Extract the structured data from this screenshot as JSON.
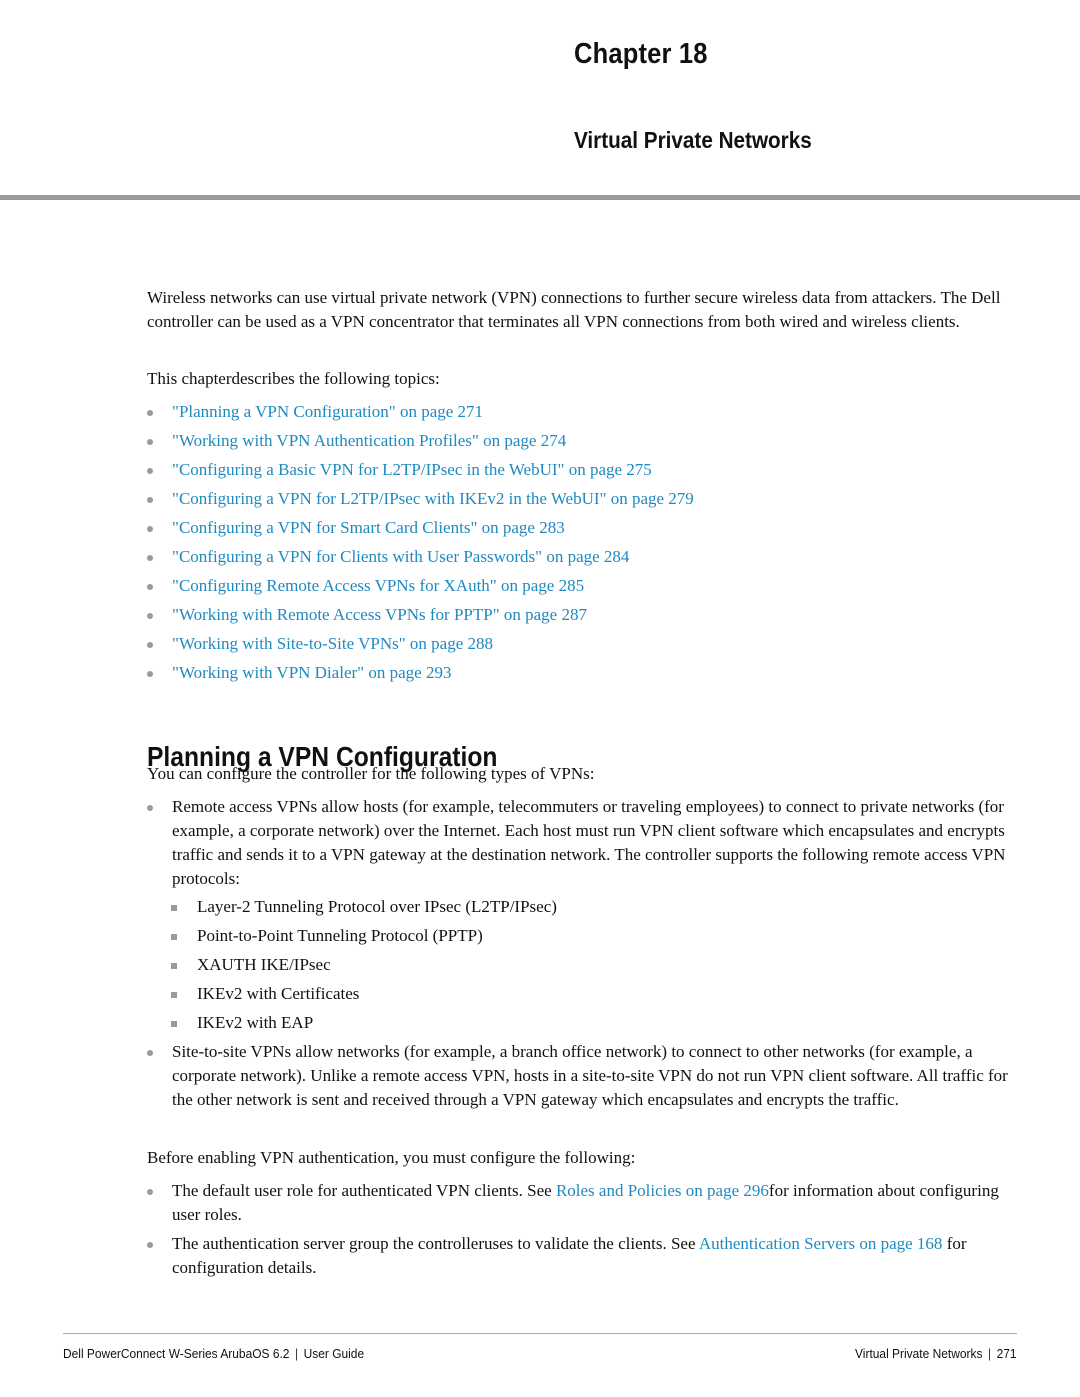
{
  "header": {
    "chapter": "Chapter 18",
    "title": "Virtual Private Networks"
  },
  "intro": {
    "paragraph": "Wireless networks can use virtual private network (VPN) connections to further secure wireless data from attackers. The Dell  controller can be used as a VPN concentrator that terminates all VPN connections from both wired and wireless clients.",
    "topics_intro": "This chapterdescribes the following topics:",
    "topics": [
      "\"Planning a VPN Configuration\" on page 271",
      "\"Working with VPN Authentication Profiles\" on page 274",
      "\"Configuring a Basic VPN for L2TP/IPsec in the WebUI\" on page 275",
      "\"Configuring a VPN for L2TP/IPsec with IKEv2 in the WebUI\" on page 279",
      "\"Configuring a VPN for Smart Card Clients\" on page 283",
      "\"Configuring a VPN for Clients with User Passwords\" on page 284",
      "\"Configuring Remote Access VPNs for XAuth\" on page 285",
      "\"Working with Remote Access VPNs for PPTP\" on page 287",
      "\"Working with Site-to-Site VPNs\" on page 288",
      "\"Working with VPN Dialer\" on page 293"
    ]
  },
  "section": {
    "heading": "Planning a VPN Configuration",
    "types_intro": "You can configure the controller for the following types of VPNs:",
    "remote_access": "Remote access VPNs allow hosts (for example, telecommuters or traveling employees) to connect to private networks (for example, a corporate network) over the Internet. Each host must run VPN client software which encapsulates and encrypts traffic and sends it to a VPN gateway at the destination network. The controller supports the following remote access VPN protocols:",
    "protocols": [
      "Layer-2 Tunneling Protocol over IPsec (L2TP/IPsec)",
      "Point-to-Point Tunneling Protocol (PPTP)",
      "XAUTH IKE/IPsec",
      "IKEv2 with Certificates",
      "IKEv2 with EAP"
    ],
    "site_to_site": "Site-to-site VPNs allow networks (for example, a branch office network) to connect to other networks (for example, a corporate network). Unlike a remote access VPN, hosts in a site-to-site VPN do not run VPN client software. All traffic for the other network is sent and received through a VPN gateway which encapsulates and encrypts the traffic.",
    "before_intro": "Before enabling VPN authentication, you must configure the following:",
    "prereqs": [
      {
        "before": "The default user role for authenticated VPN clients. See ",
        "link": "Roles and Policies on page 296",
        "after": "for information about configuring user roles."
      },
      {
        "before": "The authentication server group the controlleruses to validate the clients. See ",
        "link": "Authentication Servers on page 168",
        "after": " for configuration details."
      }
    ]
  },
  "footer": {
    "left_product": "Dell PowerConnect W-Series ArubaOS 6.2",
    "left_doc": "User Guide",
    "right_chapter": "Virtual Private Networks",
    "page_number": "271",
    "separator": "|"
  },
  "colors": {
    "link": "#1f8ac0",
    "rule": "#9b9b9b"
  }
}
